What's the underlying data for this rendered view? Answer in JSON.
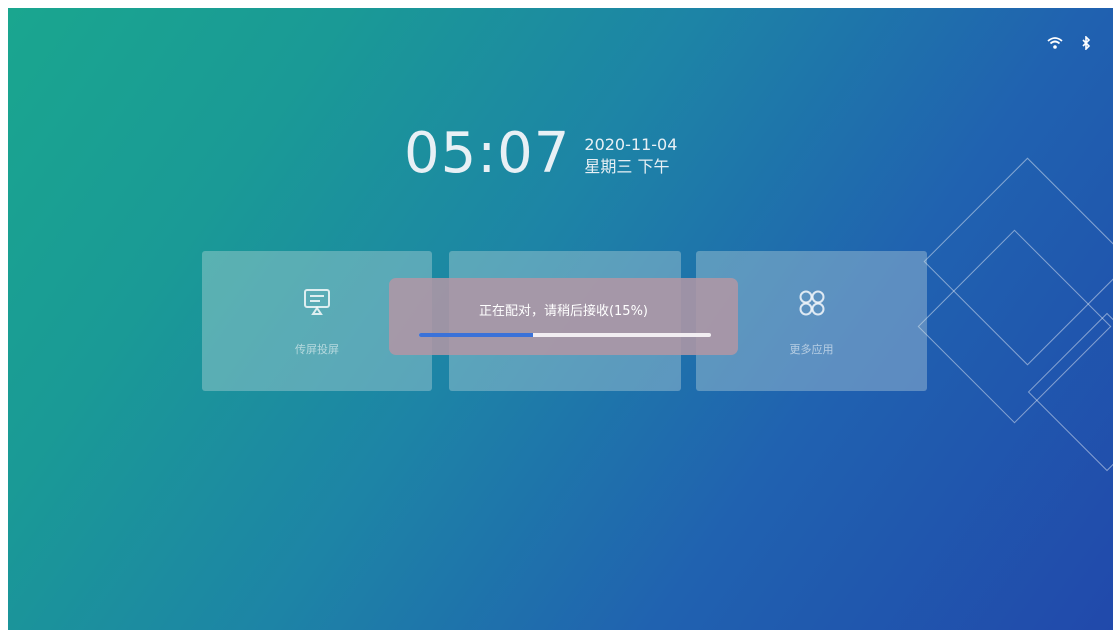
{
  "status_bar": {
    "icons": [
      "wifi-icon",
      "bluetooth-icon"
    ]
  },
  "clock": {
    "time": "05:07",
    "date": "2020-11-04",
    "weekday_period": "星期三 下午"
  },
  "tiles": [
    {
      "icon": "screen-share-icon",
      "label": "传屏投屏"
    },
    {
      "icon": "blank-icon",
      "label": ""
    },
    {
      "icon": "apps-icon",
      "label": "更多应用"
    }
  ],
  "popup": {
    "message": "正在配对，请稍后接收(15%)",
    "progress": 0.39
  },
  "colors": {
    "background_start": "#1aa68f",
    "background_end": "#2149ab",
    "progress_fill": "#3a72d9",
    "popup_bg": "#af96a5"
  }
}
